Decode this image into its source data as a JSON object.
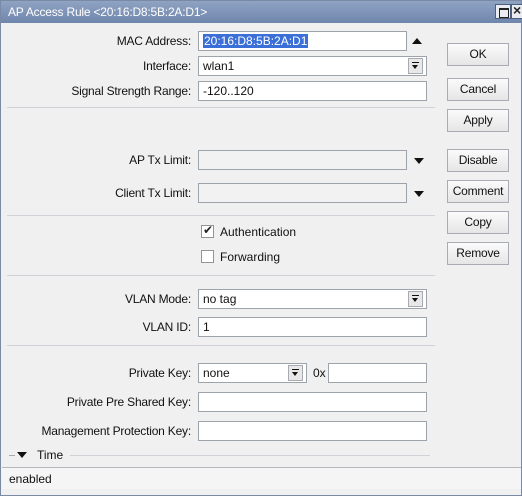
{
  "window": {
    "title": "AP Access Rule <20:16:D8:5B:2A:D1>"
  },
  "form": {
    "mac_address": {
      "label": "MAC Address:",
      "value": "20:16:D8:5B:2A:D1"
    },
    "interface": {
      "label": "Interface:",
      "value": "wlan1"
    },
    "signal_strength_range": {
      "label": "Signal Strength Range:",
      "value": "-120..120"
    },
    "ap_tx_limit": {
      "label": "AP Tx Limit:",
      "value": ""
    },
    "client_tx_limit": {
      "label": "Client Tx Limit:",
      "value": ""
    },
    "authentication": {
      "label": "Authentication",
      "checked": true
    },
    "forwarding": {
      "label": "Forwarding",
      "checked": false
    },
    "vlan_mode": {
      "label": "VLAN Mode:",
      "value": "no tag"
    },
    "vlan_id": {
      "label": "VLAN ID:",
      "value": "1"
    },
    "private_key": {
      "label": "Private Key:",
      "value": "none",
      "hex_prefix": "0x",
      "hex_value": ""
    },
    "private_pre_shared_key": {
      "label": "Private Pre Shared Key:",
      "value": ""
    },
    "management_protection_key": {
      "label": "Management Protection Key:",
      "value": ""
    },
    "time_section": {
      "label": "Time",
      "icon": "triangle-down-icon"
    }
  },
  "buttons": {
    "ok": "OK",
    "cancel": "Cancel",
    "apply": "Apply",
    "disable": "Disable",
    "comment": "Comment",
    "copy": "Copy",
    "remove": "Remove"
  },
  "status": {
    "text": "enabled"
  },
  "colors": {
    "titlebar": "#7d93b8",
    "selection": "#3a6fd8",
    "window_bg": "#f0f0f0"
  }
}
